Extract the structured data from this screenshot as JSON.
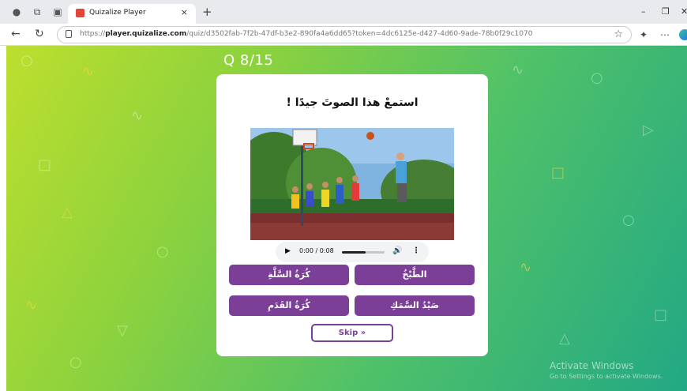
{
  "browser": {
    "tab_title": "Quizalize Player",
    "tab_close": "×",
    "new_tab": "+",
    "url_prefix": "https://",
    "url_host": "player.quizalize.com",
    "url_path": "/quiz/d3502fab-7f2b-47df-b3e2-890fa4a6dd65?token=4dc6125e-d427-4d60-9ade-78b0f29c1070"
  },
  "quiz": {
    "counter": "Q 8/15",
    "question": "استمعْ هذا الصوتَ جيدًا !",
    "image_alt": "children playing basketball",
    "audio": {
      "time": "0:00 / 0:08",
      "progress_fraction": 0.55
    },
    "options": [
      "كُرَةُ السَّلَّةِ",
      "الطَّبْخُ",
      "كُرَةُ القَدَمِ",
      "صَيْدُ السَّمَكِ"
    ],
    "skip_label": "Skip »"
  },
  "watermark": {
    "title": "Activate Windows",
    "subtitle": "Go to Settings to activate Windows."
  },
  "colors": {
    "accent": "#7b3f98",
    "bg_start": "#bddf2e",
    "bg_end": "#22a884"
  }
}
